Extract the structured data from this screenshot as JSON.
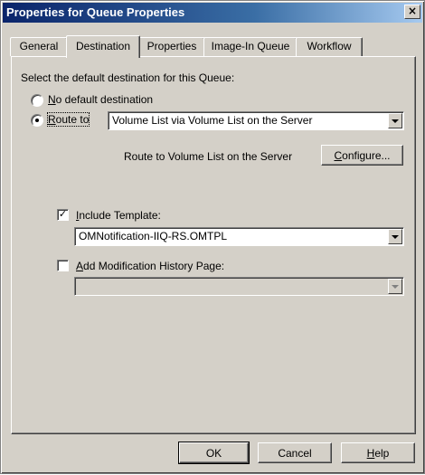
{
  "window": {
    "title": "Properties for Queue Properties",
    "close_glyph": "×"
  },
  "tabs": [
    {
      "label": "General",
      "active": false
    },
    {
      "label": "Destination",
      "active": true
    },
    {
      "label": "Properties",
      "active": false
    },
    {
      "label": "Image-In Queue",
      "active": false
    },
    {
      "label": "Workflow",
      "active": false
    }
  ],
  "destination": {
    "prompt": "Select the default destination for this Queue:",
    "no_default": {
      "accel": "N",
      "rest": "o default destination",
      "selected": false
    },
    "route_to": {
      "accel": "R",
      "rest": "oute to",
      "selected": true
    },
    "route_select_value": "Volume List via Volume List on the Server",
    "route_description": "Route to Volume List on the Server",
    "configure_button": {
      "accel": "C",
      "rest": "onfigure..."
    },
    "include_template": {
      "accel": "I",
      "rest": "nclude Template:",
      "checked": true
    },
    "template_select_value": "OMNotification-IIQ-RS.OMTPL",
    "add_history": {
      "accel": "A",
      "rest": "dd Modification History Page:",
      "checked": false
    },
    "history_select_value": ""
  },
  "footer": {
    "ok_label": "OK",
    "cancel_label": "Cancel",
    "help": {
      "accel": "H",
      "rest": "elp"
    }
  },
  "icons": [
    "close-icon",
    "radio-button-icon",
    "checkbox-icon",
    "dropdown-arrow-icon"
  ]
}
